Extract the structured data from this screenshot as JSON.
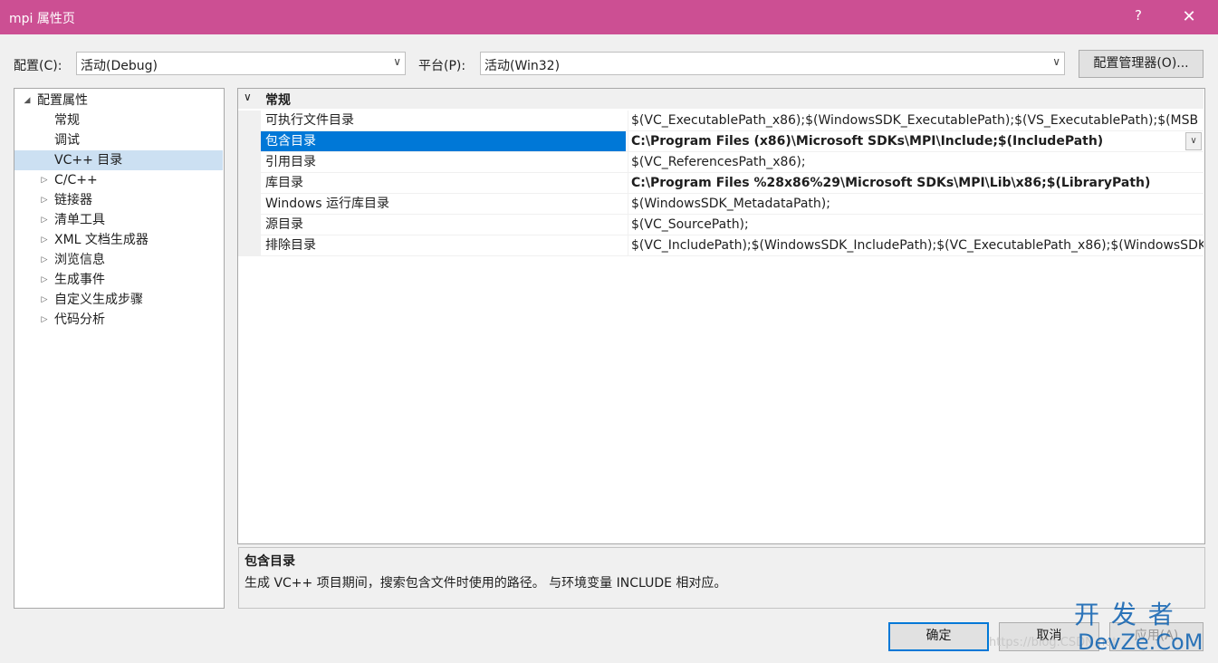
{
  "window": {
    "title": "mpi 属性页",
    "help_label": "?",
    "close_label": "✕"
  },
  "toolbar": {
    "config_label": "配置(C):",
    "config_value": "活动(Debug)",
    "platform_label": "平台(P):",
    "platform_value": "活动(Win32)",
    "config_manager_label": "配置管理器(O)..."
  },
  "tree": [
    {
      "label": "配置属性",
      "twisty": "◢"
    },
    {
      "label": "常规",
      "twisty": ""
    },
    {
      "label": "调试",
      "twisty": ""
    },
    {
      "label": "VC++ 目录",
      "twisty": "",
      "selected": true
    },
    {
      "label": "C/C++",
      "twisty": "▷"
    },
    {
      "label": "链接器",
      "twisty": "▷"
    },
    {
      "label": "清单工具",
      "twisty": "▷"
    },
    {
      "label": "XML 文档生成器",
      "twisty": "▷"
    },
    {
      "label": "浏览信息",
      "twisty": "▷"
    },
    {
      "label": "生成事件",
      "twisty": "▷"
    },
    {
      "label": "自定义生成步骤",
      "twisty": "▷"
    },
    {
      "label": "代码分析",
      "twisty": "▷"
    }
  ],
  "grid": {
    "section_twisty": "∨",
    "section_label": "常规",
    "rows": [
      {
        "name": "可执行文件目录",
        "value": "$(VC_ExecutablePath_x86);$(WindowsSDK_ExecutablePath);$(VS_ExecutablePath);$(MSB",
        "bold": false
      },
      {
        "name": "包含目录",
        "value": "C:\\Program Files (x86)\\Microsoft SDKs\\MPI\\Include;$(IncludePath)",
        "bold": true,
        "selected": true
      },
      {
        "name": "引用目录",
        "value": "$(VC_ReferencesPath_x86);",
        "bold": false
      },
      {
        "name": "库目录",
        "value": "C:\\Program Files %28x86%29\\Microsoft SDKs\\MPI\\Lib\\x86;$(LibraryPath)",
        "bold": true
      },
      {
        "name": "Windows 运行库目录",
        "value": "$(WindowsSDK_MetadataPath);",
        "bold": false
      },
      {
        "name": "源目录",
        "value": "$(VC_SourcePath);",
        "bold": false
      },
      {
        "name": "排除目录",
        "value": "$(VC_IncludePath);$(WindowsSDK_IncludePath);$(VC_ExecutablePath_x86);$(WindowsSDK",
        "bold": false
      }
    ]
  },
  "description": {
    "title": "包含目录",
    "text": "生成 VC++ 项目期间，搜索包含文件时使用的路径。 与环境变量 INCLUDE 相对应。"
  },
  "buttons": {
    "ok_label": "确定",
    "cancel_label": "取消",
    "apply_label": "应用(A)"
  },
  "watermark": {
    "line1": "开 发 者",
    "line2": "DevZe.CoM",
    "faint": "https://blog.CSDN.net"
  },
  "colors": {
    "titlebar": "#cc4f93",
    "accent": "#0078d7",
    "tree_selected": "#cce0f2"
  }
}
